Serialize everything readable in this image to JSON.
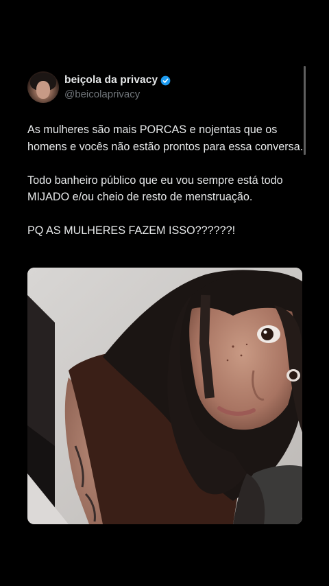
{
  "tweet": {
    "author": {
      "display_name": "beiçola da privacy",
      "handle": "@beicolaprivacy",
      "verified": true,
      "verified_color": "#1d9bf0",
      "avatar_icon": "user-avatar-photo"
    },
    "paragraphs": [
      "As mulheres são mais PORCAS e nojentas que os homens e vocês não estão prontos para essa conversa.",
      "Todo banheiro público que eu vou sempre está todo MIJADO e/ou cheio de resto de menstruação.",
      "PQ AS MULHERES FAZEM ISSO??????!"
    ],
    "media": {
      "type": "photo",
      "subject": "selfie"
    }
  },
  "colors": {
    "background": "#000000",
    "text_primary": "#e7e9ea",
    "text_secondary": "#71767b"
  }
}
